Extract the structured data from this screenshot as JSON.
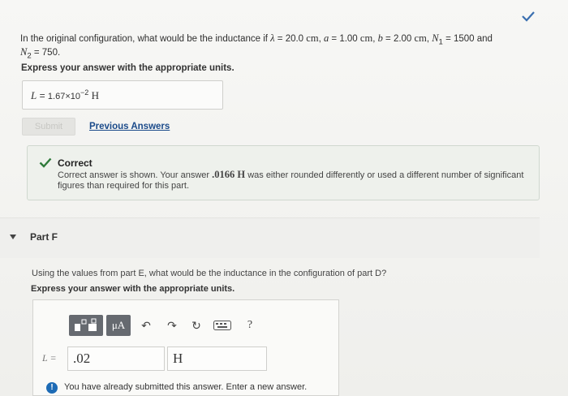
{
  "question": {
    "prefix": "In the original configuration, what would be the inductance if",
    "lambda_sym": "λ",
    "lambda_val": "= 20.0",
    "lambda_unit": "cm",
    "a_sym": "a",
    "a_val": "= 1.00",
    "a_unit": "cm",
    "b_sym": "b",
    "b_val": "= 2.00",
    "b_unit": "cm",
    "n1_sym": "N",
    "n1_sub": "1",
    "n1_val": "= 1500 and",
    "n2_sym": "N",
    "n2_sub": "2",
    "n2_val": "= 750."
  },
  "instruction": "Express your answer with the appropriate units.",
  "previous_answer": {
    "label": "L",
    "eq": " = ",
    "mantissa": "1.67×10",
    "exponent": "−2",
    "unit": "H"
  },
  "submit_label": "Submit",
  "previous_answers_label": "Previous Answers",
  "feedback": {
    "title": "Correct",
    "msg_before": "Correct answer is shown. Your answer ",
    "msg_value": ".0166 H",
    "msg_after": " was either rounded differently or used a different number of significant figures than required for this part."
  },
  "part": {
    "title": "Part F",
    "question": "Using the values from part E, what would be the inductance in the configuration of part D?",
    "instruction": "Express your answer with the appropriate units."
  },
  "toolbar": {
    "units_label": "μA",
    "help_label": "?"
  },
  "input": {
    "label": "L =",
    "value": ".02",
    "unit": "H"
  },
  "info": {
    "icon": "!",
    "message": "You have already submitted this answer. Enter a new answer."
  },
  "colors": {
    "link": "#1a4a8a",
    "check": "#2f7a3a",
    "info": "#1d6bb5"
  }
}
